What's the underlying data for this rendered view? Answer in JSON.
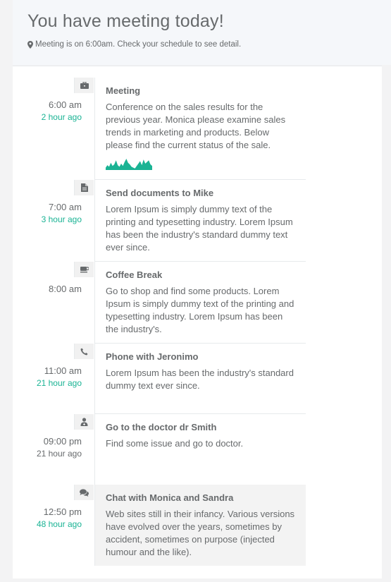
{
  "header": {
    "title": "You have meeting today!",
    "subtitle": "Meeting is on 6:00am. Check your schedule to see detail."
  },
  "timeline": [
    {
      "time": "6:00 am",
      "ago": "2 hour ago",
      "ago_color": "#1ab394",
      "icon": "briefcase-icon",
      "title": "Meeting",
      "text": "Conference on the sales results for the previous year. Monica please examine sales trends in marketing and products. Below please find the current status of the sale.",
      "sparkline": [
        3,
        6,
        4,
        9,
        5,
        7,
        12,
        6,
        4,
        8,
        5,
        10,
        14,
        9,
        7,
        4,
        3,
        2,
        5,
        8,
        11,
        6,
        13,
        8,
        10,
        12,
        7,
        5
      ]
    },
    {
      "time": "7:00 am",
      "ago": "3 hour ago",
      "ago_color": "#1ab394",
      "icon": "document-icon",
      "title": "Send documents to Mike",
      "text": "Lorem Ipsum is simply dummy text of the printing and typesetting industry. Lorem Ipsum has been the industry's standard dummy text ever since."
    },
    {
      "time": "8:00 am",
      "ago": "",
      "icon": "coffee-icon",
      "title": "Coffee Break",
      "text": "Go to shop and find some products. Lorem Ipsum is simply dummy text of the printing and typesetting industry. Lorem Ipsum has been the industry's."
    },
    {
      "time": "11:00 am",
      "ago": "21 hour ago",
      "ago_color": "#1ab394",
      "icon": "phone-icon",
      "title": "Phone with Jeronimo",
      "text": "Lorem Ipsum has been the industry's standard dummy text ever since."
    },
    {
      "time": "09:00 pm",
      "ago": "21 hour ago",
      "ago_color": "#676a6c",
      "icon": "user-md-icon",
      "title": "Go to the doctor dr Smith",
      "text": "Find some issue and go to doctor."
    },
    {
      "time": "12:50 pm",
      "ago": "48 hour ago",
      "ago_color": "#1ab394",
      "icon": "comments-icon",
      "title": "Chat with Monica and Sandra",
      "text": "Web sites still in their infancy. Various versions have evolved over the years, sometimes by accident, sometimes on purpose (injected humour and the like)."
    }
  ]
}
